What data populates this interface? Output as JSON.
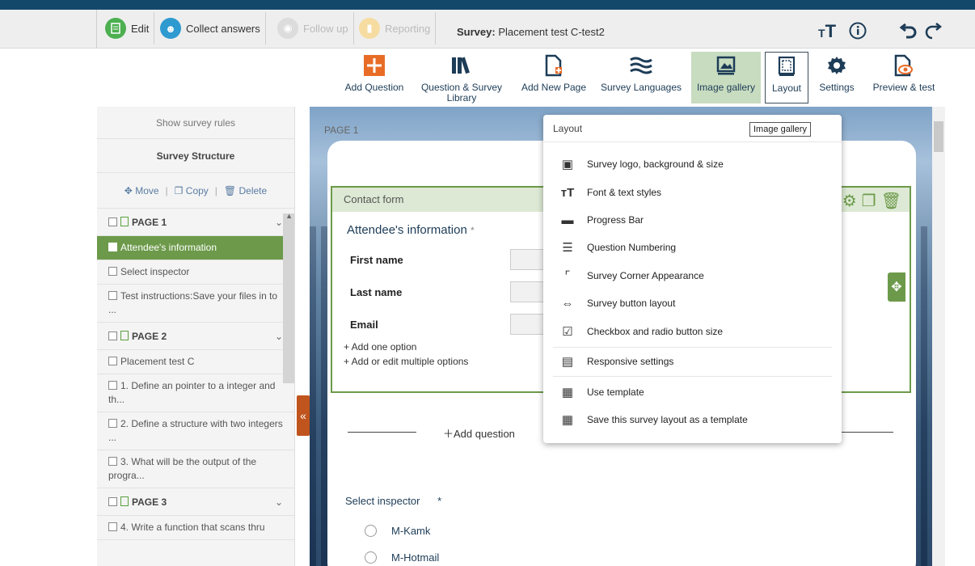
{
  "colors": {
    "brand_dark": "#13486a",
    "accent_green": "#6c9a4a",
    "accent_orange": "#e86c26"
  },
  "tabs": [
    {
      "label": "Edit",
      "icon": "edit-icon",
      "state": "active"
    },
    {
      "label": "Collect answers",
      "icon": "people-icon",
      "state": "normal"
    },
    {
      "label": "Follow up",
      "icon": "eye-icon",
      "state": "disabled"
    },
    {
      "label": "Reporting",
      "icon": "chart-icon",
      "state": "disabled"
    }
  ],
  "survey": {
    "prefix": "Survey:",
    "name": "Placement test C-test2"
  },
  "toolbar": {
    "add_question": "Add Question",
    "library": "Question & Survey Library",
    "add_page": "Add New Page",
    "languages": "Survey Languages",
    "image_gallery": "Image gallery",
    "layout": "Layout",
    "settings": "Settings",
    "preview": "Preview & test"
  },
  "sidebar": {
    "show_rules": "Show survey rules",
    "structure_title": "Survey Structure",
    "move": "Move",
    "copy": "Copy",
    "delete": "Delete",
    "items": [
      {
        "label": "PAGE 1",
        "type": "page"
      },
      {
        "label": "Attendee's information",
        "type": "question",
        "selected": true
      },
      {
        "label": "Select inspector",
        "type": "question"
      },
      {
        "label": "Test instructions:Save your files in to ...",
        "type": "question"
      },
      {
        "label": "PAGE 2",
        "type": "page"
      },
      {
        "label": "Placement test C",
        "type": "question"
      },
      {
        "label": "1. Define an pointer to a integer and th...",
        "type": "question"
      },
      {
        "label": "2. Define a structure with two integers ...",
        "type": "question"
      },
      {
        "label": "3. What will be the output of the progra...",
        "type": "question"
      },
      {
        "label": "PAGE 3",
        "type": "page"
      },
      {
        "label": "4. Write a function that scans thru",
        "type": "question"
      }
    ]
  },
  "canvas": {
    "page_label": "PAGE 1",
    "contact_header": "Contact form",
    "question_title": "Attendee's information",
    "required_mark": "*",
    "fields": [
      "First name",
      "Last name",
      "Email"
    ],
    "add_one_option": "+ Add one option",
    "add_multiple": "+ Add or edit multiple options",
    "add_question": "Add question",
    "select_title": "Select inspector",
    "select_required": "*",
    "options": [
      "M-Kamk",
      "M-Hotmail"
    ]
  },
  "layout_menu": {
    "header": "Layout",
    "tooltip": "Image gallery",
    "items": [
      {
        "label": "Survey logo, background & size",
        "icon": "image-icon"
      },
      {
        "label": "Font & text styles",
        "icon": "font-size-icon"
      },
      {
        "label": "Progress Bar",
        "icon": "progress-bar-icon"
      },
      {
        "label": "Question Numbering",
        "icon": "numbered-list-icon"
      },
      {
        "label": "Survey Corner Appearance",
        "icon": "corner-icon"
      },
      {
        "label": "Survey button layout",
        "icon": "arrows-icon"
      },
      {
        "label": "Checkbox and radio button size",
        "icon": "checkbox-icon"
      },
      {
        "label": "Responsive settings",
        "icon": "devices-icon"
      },
      {
        "label": "Use template",
        "icon": "template-icon"
      },
      {
        "label": "Save this survey layout as a template",
        "icon": "save-template-icon"
      }
    ]
  }
}
